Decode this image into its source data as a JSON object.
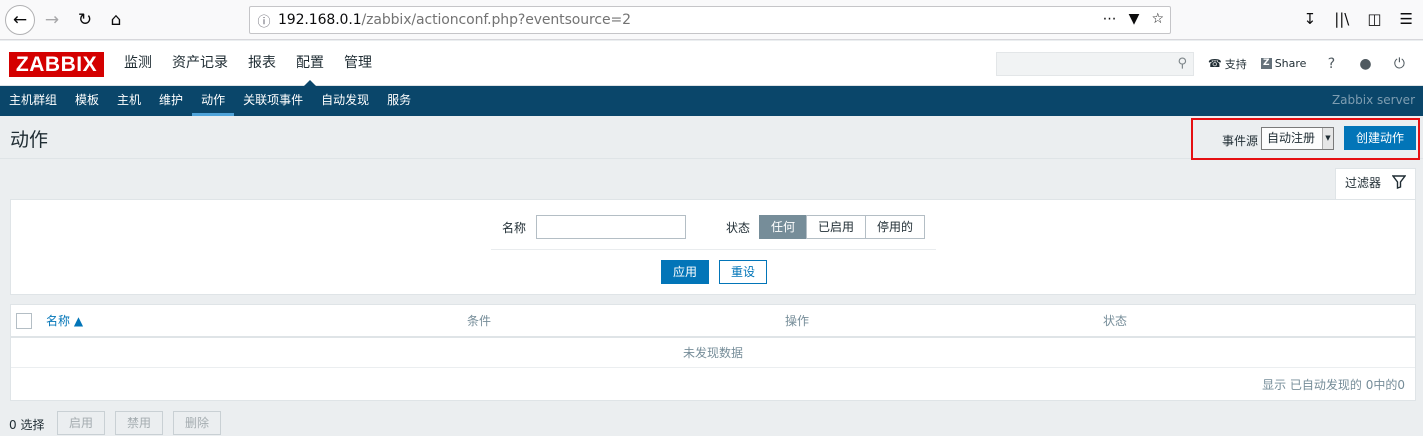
{
  "browser": {
    "url_host": "192.168.0.1",
    "url_path": "/zabbix/actionconf.php?eventsource=2"
  },
  "header": {
    "logo": "ZABBIX",
    "menu": [
      "监测",
      "资产记录",
      "报表",
      "配置",
      "管理"
    ],
    "active_menu": "配置",
    "support": "支持",
    "share": "Share",
    "help": "?"
  },
  "subnav": {
    "items": [
      "主机群组",
      "模板",
      "主机",
      "维护",
      "动作",
      "关联项事件",
      "自动发现",
      "服务"
    ],
    "active": "动作",
    "server": "Zabbix server"
  },
  "page": {
    "title": "动作",
    "event_source_label": "事件源",
    "event_source_value": "自动注册",
    "create_button": "创建动作"
  },
  "filter": {
    "tab": "过滤器",
    "name_label": "名称",
    "status_label": "状态",
    "status_options": [
      "任何",
      "已启用",
      "停用的"
    ],
    "status_selected": "任何",
    "apply": "应用",
    "reset": "重设"
  },
  "table": {
    "headers": [
      "名称 ▲",
      "条件",
      "操作",
      "状态"
    ],
    "empty": "未发现数据",
    "page_info": "显示 已自动发现的 0中的0"
  },
  "footer": {
    "selected": "0 选择",
    "buttons": [
      "启用",
      "禁用",
      "删除"
    ]
  },
  "colors": {
    "brand_red": "#d40000",
    "nav_blue": "#0a466a",
    "primary": "#0275b8",
    "highlight_box": "#e50f12"
  }
}
